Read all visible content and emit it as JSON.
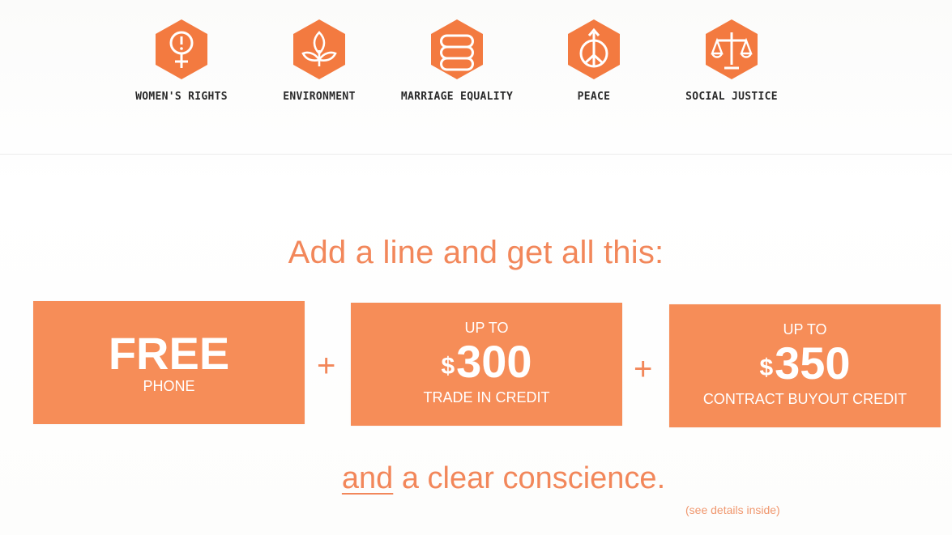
{
  "colors": {
    "accent": "#f68d58",
    "icon_hex": "#f37a40",
    "text_orange": "#f2875a"
  },
  "causes": [
    {
      "label": "WOMEN'S RIGHTS",
      "icon": "womens-rights-icon"
    },
    {
      "label": "ENVIRONMENT",
      "icon": "environment-icon"
    },
    {
      "label": "MARRIAGE EQUALITY",
      "icon": "marriage-equality-icon"
    },
    {
      "label": "PEACE",
      "icon": "peace-icon"
    },
    {
      "label": "SOCIAL JUSTICE",
      "icon": "social-justice-icon"
    }
  ],
  "headline": "Add a line and get all this:",
  "offers": [
    {
      "top": "",
      "main": "FREE",
      "bottom": "PHONE"
    },
    {
      "top": "UP TO",
      "currency": "$",
      "main": "300",
      "bottom": "TRADE IN CREDIT"
    },
    {
      "top": "UP TO",
      "currency": "$",
      "main": "350",
      "bottom": "CONTRACT BUYOUT CREDIT"
    }
  ],
  "plus_sign": "+",
  "tagline": {
    "underlined": "and",
    "rest": " a clear conscience."
  },
  "details": "(see details inside)"
}
